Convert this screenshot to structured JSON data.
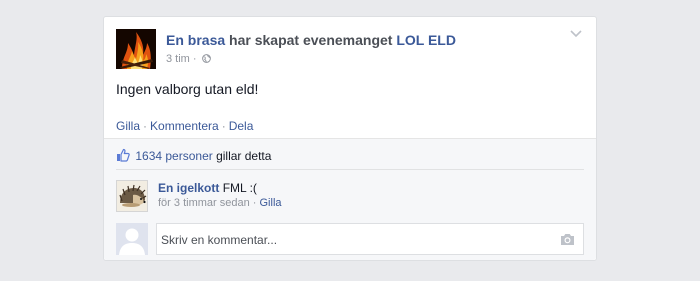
{
  "post": {
    "author": "En brasa",
    "action_text": "har skapat evenemanget",
    "event_name": "LOL ELD",
    "time": "3 tim",
    "meta_sep": "·",
    "status": "Ingen valborg utan eld!",
    "author_pic_icon": "fire-icon",
    "privacy_icon": "globe-icon",
    "options_icon": "chevron-down-icon"
  },
  "actions": {
    "like": "Gilla",
    "comment": "Kommentera",
    "share": "Dela",
    "sep": "·"
  },
  "likes": {
    "count_text": "1634 personer",
    "suffix": "gillar detta",
    "icon": "thumbs-up-icon"
  },
  "comments": [
    {
      "author": "En igelkott",
      "text": "FML :(",
      "time": "för 3 timmar sedan",
      "like": "Gilla",
      "sep": "·",
      "avatar_icon": "hedgehog-icon"
    }
  ],
  "compose": {
    "placeholder": "Skriv en kommentar...",
    "camera_icon": "camera-icon",
    "avatar_icon": "default-avatar-icon"
  },
  "colors": {
    "background": "#e9eaed",
    "link": "#3b5998",
    "text": "#141823",
    "muted": "#90949c",
    "ufi_background": "#f6f7f9"
  }
}
